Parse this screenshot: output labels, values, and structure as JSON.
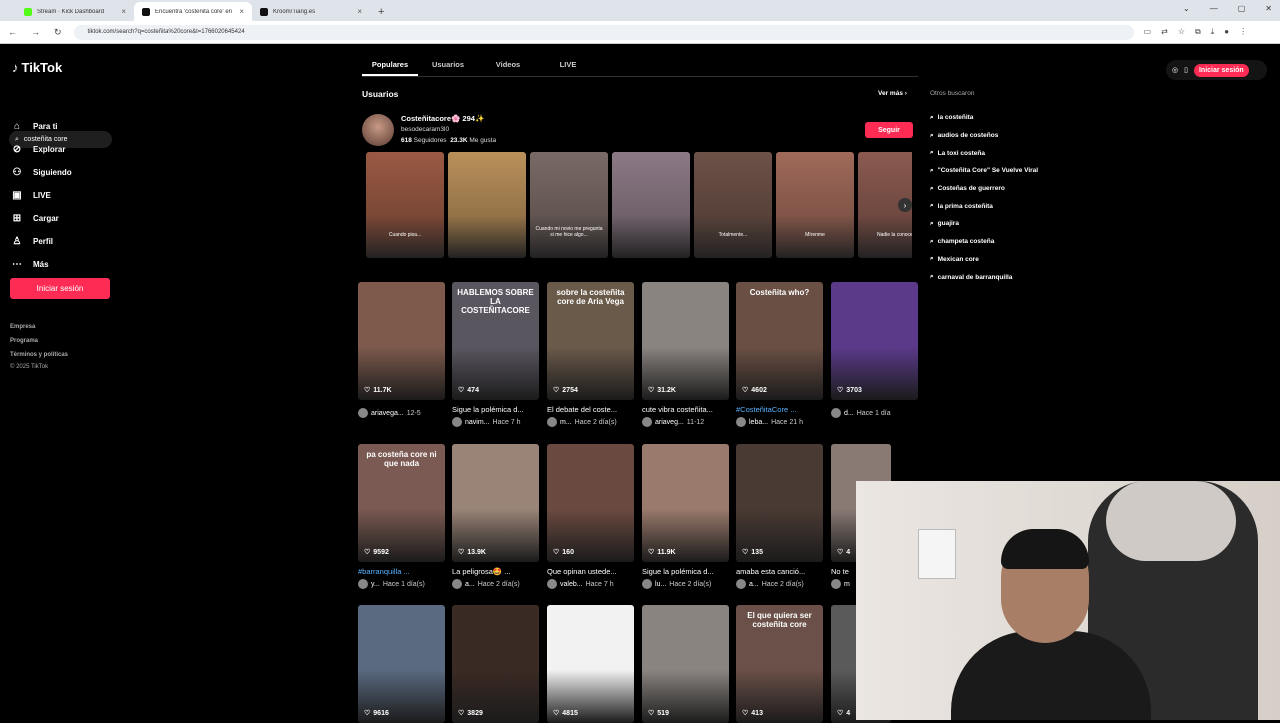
{
  "browser": {
    "tabs": [
      {
        "title": "Stream · Kick Dashboard",
        "color": "#53fc18",
        "active": false
      },
      {
        "title": "Encuentra 'costeñita core' en TikTok",
        "color": "#111111",
        "active": true
      },
      {
        "title": "Kroom/Tiang.es",
        "color": "#111111",
        "active": false
      }
    ],
    "new_tab": "+",
    "url": "tiktok.com/search?q=costeñita%20core&t=1766020645424"
  },
  "sidebar": {
    "logo": "TikTok",
    "search_value": "costeñita core",
    "nav": [
      {
        "label": "Para ti",
        "icon": "home-icon",
        "glyph": "⌂"
      },
      {
        "label": "Explorar",
        "icon": "compass-icon",
        "glyph": "⊘"
      },
      {
        "label": "Siguiendo",
        "icon": "following-icon",
        "glyph": "⚇"
      },
      {
        "label": "LIVE",
        "icon": "live-icon",
        "glyph": "▣"
      },
      {
        "label": "Cargar",
        "icon": "upload-icon",
        "glyph": "⊞"
      },
      {
        "label": "Perfil",
        "icon": "profile-icon",
        "glyph": "♙"
      },
      {
        "label": "Más",
        "icon": "more-icon",
        "glyph": "⋯"
      }
    ],
    "login": "Iniciar sesión",
    "footer": [
      "Empresa",
      "Programa",
      "Términos y políticas"
    ],
    "copyright": "© 2025 TikTok"
  },
  "search_tabs": [
    "Populares",
    "Usuarios",
    "Videos",
    "LIVE"
  ],
  "users_section": {
    "heading": "Usuarios",
    "see_more": "Ver más",
    "name": "Costeñitacore🌸 294✨",
    "handle": "besodecaram3l0",
    "followers_count": "618",
    "followers_label": "Seguidores",
    "likes_count": "23.3K",
    "likes_label": "Me gusta",
    "follow": "Seguir",
    "strip": [
      {
        "caption": "Cuando pisa...",
        "color": "#9a5a44"
      },
      {
        "caption": "",
        "color": "#b9905a"
      },
      {
        "caption": "Cuando mi novio me pregunta si me hice algo...",
        "color": "#7a6a66"
      },
      {
        "caption": "",
        "color": "#8c7a86"
      },
      {
        "caption": "Totalmente...",
        "color": "#6d5248"
      },
      {
        "caption": "Mírenme",
        "color": "#a06a5a"
      },
      {
        "caption": "Nadie la conoce...",
        "color": "#8a5a50"
      }
    ]
  },
  "videos": [
    {
      "overlay": "",
      "likes": "11.7K",
      "title": "",
      "author": "ariavega...",
      "time": "12-5",
      "color": "#7d5a4c",
      "tag": false
    },
    {
      "overlay": "HABLEMOS SOBRE LA COSTEÑITACORE",
      "likes": "474",
      "title": "Sigue la polémica d...",
      "author": "navim...",
      "time": "Hace 7 h",
      "color": "#5a5660",
      "tag": false
    },
    {
      "overlay": "sobre la costeñita core de Aria Vega",
      "likes": "2754",
      "title": "El debate del coste...",
      "author": "m...",
      "time": "Hace 2 día(s)",
      "color": "#6a5a4a",
      "tag": false
    },
    {
      "overlay": "",
      "likes": "31.2K",
      "title": "cute vibra costeñita...",
      "author": "ariaveg...",
      "time": "11-12",
      "color": "#8a8480",
      "tag": false
    },
    {
      "overlay": "Costeñita who?",
      "likes": "4602",
      "title": "#CosteñitaCore ...",
      "author": "leba...",
      "time": "Hace 21 h",
      "color": "#6a5044",
      "tag": true
    },
    {
      "overlay": "",
      "likes": "3703",
      "title": "",
      "author": "d...",
      "time": "Hace 1 día(s)",
      "color": "#5b3a8a",
      "tag": false
    },
    {
      "overlay": "pa costeña core ni que nada",
      "likes": "9592",
      "title": "#barranquilla ...",
      "author": "y...",
      "time": "Hace 1 día(s)",
      "color": "#7a5a52",
      "tag": true
    },
    {
      "overlay": "",
      "likes": "13.9K",
      "title": "La peligrosa🤩 ...",
      "author": "a...",
      "time": "Hace 2 día(s)",
      "color": "#9a8478",
      "tag": false
    },
    {
      "overlay": "",
      "likes": "160",
      "title": "Que opinan ustede...",
      "author": "valeb...",
      "time": "Hace 7 h",
      "color": "#6a4a40",
      "tag": false
    },
    {
      "overlay": "",
      "likes": "11.9K",
      "title": "Sigue la polémica d...",
      "author": "lu...",
      "time": "Hace 2 día(s)",
      "color": "#9a7a6c",
      "tag": false
    },
    {
      "overlay": "",
      "likes": "135",
      "title": "amaba esta canció...",
      "author": "a...",
      "time": "Hace 2 día(s)",
      "color": "#4a3a34",
      "tag": false
    },
    {
      "overlay": "",
      "likes": "4",
      "title": "No te",
      "author": "m",
      "time": "",
      "color": "#8a7a74",
      "tag": false
    },
    {
      "overlay": "",
      "likes": "9616",
      "title": "",
      "author": "",
      "time": "",
      "color": "#5a6a80",
      "tag": false
    },
    {
      "overlay": "",
      "likes": "3829",
      "title": "",
      "author": "",
      "time": "",
      "color": "#3a2a24",
      "tag": false
    },
    {
      "overlay": "",
      "likes": "4815",
      "title": "",
      "author": "",
      "time": "",
      "color": "#f2f2f2",
      "tag": false
    },
    {
      "overlay": "",
      "likes": "519",
      "title": "",
      "author": "",
      "time": "",
      "color": "#8a8480",
      "tag": false
    },
    {
      "overlay": "El que quiera ser costeñita core",
      "likes": "413",
      "title": "",
      "author": "",
      "time": "",
      "color": "#6a5048",
      "tag": false
    },
    {
      "overlay": "",
      "likes": "4",
      "title": "",
      "author": "",
      "time": "",
      "color": "#5a5a5a",
      "tag": false
    }
  ],
  "right": {
    "login": "Iniciar sesión",
    "others_heading": "Otros buscaron",
    "suggestions": [
      "la costeñita",
      "audios de costeños",
      "La toxi costeña",
      "\"Costeñita Core\" Se Vuelve Viral",
      "Costeñas de guerrero",
      "la prima costeñita",
      "guajira",
      "champeta costeña",
      "Mexican core",
      "carnaval de barranquilla"
    ]
  }
}
